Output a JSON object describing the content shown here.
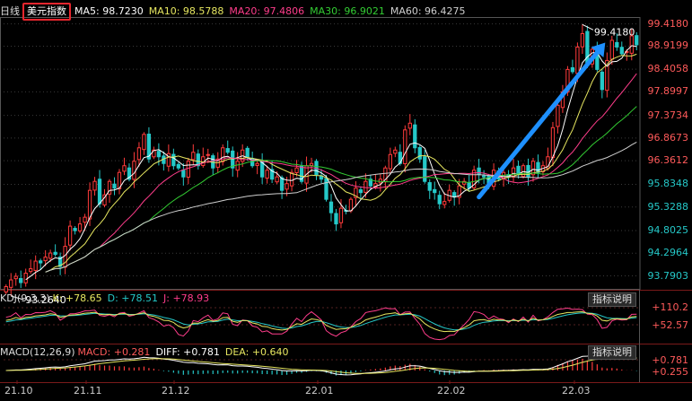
{
  "header": {
    "period": "日线",
    "symbol": "美元指数",
    "ma": [
      {
        "label": "MA5: 98.7230",
        "color": "#ffffff"
      },
      {
        "label": "MA10: 98.5788",
        "color": "#e6e660"
      },
      {
        "label": "MA20: 97.4806",
        "color": "#ff3d8b"
      },
      {
        "label": "MA30: 96.9021",
        "color": "#33cc33"
      },
      {
        "label": "MA60: 96.4275",
        "color": "#cfcfcf"
      }
    ]
  },
  "kdj": {
    "title": "KDJ(9,3,3)",
    "k": "K: +78.65",
    "d": "D: +78.51",
    "j": "J: +78.93",
    "levels": [
      "+110.2",
      "+52.57"
    ],
    "button": "指标说明"
  },
  "macd": {
    "title": "MACD(12,26,9)",
    "macd": "MACD: +0.281",
    "diff": "DIFF: +0.781",
    "dea": "DEA: +0.640",
    "levels": [
      "+0.781",
      "+0.255"
    ],
    "button": "指标说明"
  },
  "chart_data": {
    "type": "candlestick",
    "y_ticks": [
      "99.4180",
      "98.9199",
      "98.4058",
      "97.8997",
      "97.3734",
      "96.8673",
      "96.3612",
      "95.8348",
      "95.3288",
      "94.8025",
      "94.2964",
      "93.7903"
    ],
    "ylim": [
      93.5,
      99.55
    ],
    "x_ticks": [
      "21.10",
      "21.11",
      "21.12",
      "22.01",
      "22.02",
      "22.03"
    ],
    "annotations": {
      "low": "93.2640",
      "high": "99.4180"
    },
    "colors": {
      "up": "#ff3b3b",
      "down": "#25c8c8",
      "ma5": "#ffffff",
      "ma10": "#e6e660",
      "ma20": "#ff3d8b",
      "ma30": "#33cc33",
      "ma60": "#cfcfcf",
      "arrow": "#1e90ff"
    },
    "close": [
      93.55,
      93.7,
      93.78,
      93.64,
      93.85,
      93.95,
      94.12,
      94.08,
      94.21,
      94.3,
      94.27,
      94.0,
      94.45,
      94.9,
      94.8,
      94.95,
      95.1,
      95.7,
      95.9,
      95.4,
      95.6,
      95.9,
      95.75,
      96.1,
      96.25,
      95.95,
      96.35,
      96.65,
      96.95,
      96.4,
      96.6,
      96.45,
      96.3,
      96.52,
      96.25,
      96.2,
      96.0,
      96.35,
      96.55,
      96.25,
      96.45,
      96.5,
      96.2,
      96.4,
      96.65,
      96.55,
      96.2,
      96.35,
      96.6,
      96.45,
      96.25,
      96.3,
      96.0,
      96.15,
      95.95,
      96.0,
      95.7,
      95.85,
      96.1,
      96.2,
      95.9,
      96.25,
      96.3,
      96.05,
      95.95,
      95.5,
      95.2,
      94.95,
      95.3,
      95.25,
      95.5,
      95.75,
      95.65,
      95.9,
      95.8,
      95.85,
      95.95,
      96.2,
      96.5,
      96.6,
      96.3,
      97.05,
      97.2,
      96.65,
      96.4,
      95.9,
      95.7,
      95.65,
      95.4,
      95.45,
      95.7,
      95.55,
      95.8,
      95.9,
      95.75,
      96.15,
      96.05,
      96.0,
      95.85,
      96.15,
      95.95,
      96.1,
      96.0,
      96.2,
      96.05,
      96.25,
      96.0,
      96.35,
      96.1,
      96.25,
      96.45,
      97.1,
      97.6,
      97.9,
      98.4,
      98.35,
      98.9,
      99.2,
      98.55,
      98.85,
      98.4,
      97.95,
      98.6,
      99.05,
      98.9,
      98.75,
      98.8,
      99.15,
      98.95
    ]
  }
}
